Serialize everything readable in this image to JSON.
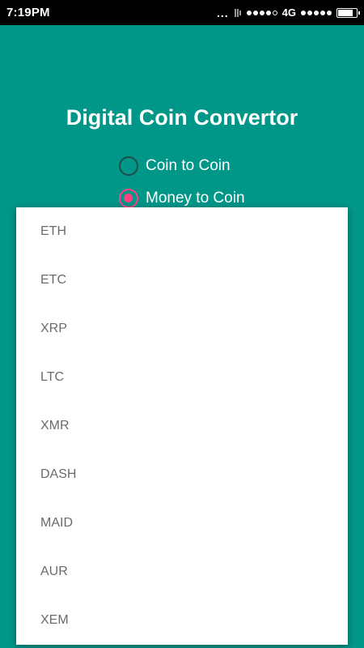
{
  "status_bar": {
    "time": "7:19PM",
    "more": "...",
    "network": "4G",
    "icons": [
      "more-dots-icon",
      "vibrate-icon",
      "signal-dots-icon",
      "network-4g",
      "signal-dots-icon",
      "battery-icon"
    ]
  },
  "app": {
    "title": "Digital Coin Convertor",
    "radio_options": [
      {
        "label": "Coin to Coin",
        "checked": false
      },
      {
        "label": "Money to Coin",
        "checked": true
      }
    ],
    "accent_color": "#ff4081",
    "background_color": "#009688"
  },
  "dropdown": {
    "items": [
      "ETH",
      "ETC",
      "XRP",
      "LTC",
      "XMR",
      "DASH",
      "MAID",
      "AUR",
      "XEM"
    ]
  }
}
